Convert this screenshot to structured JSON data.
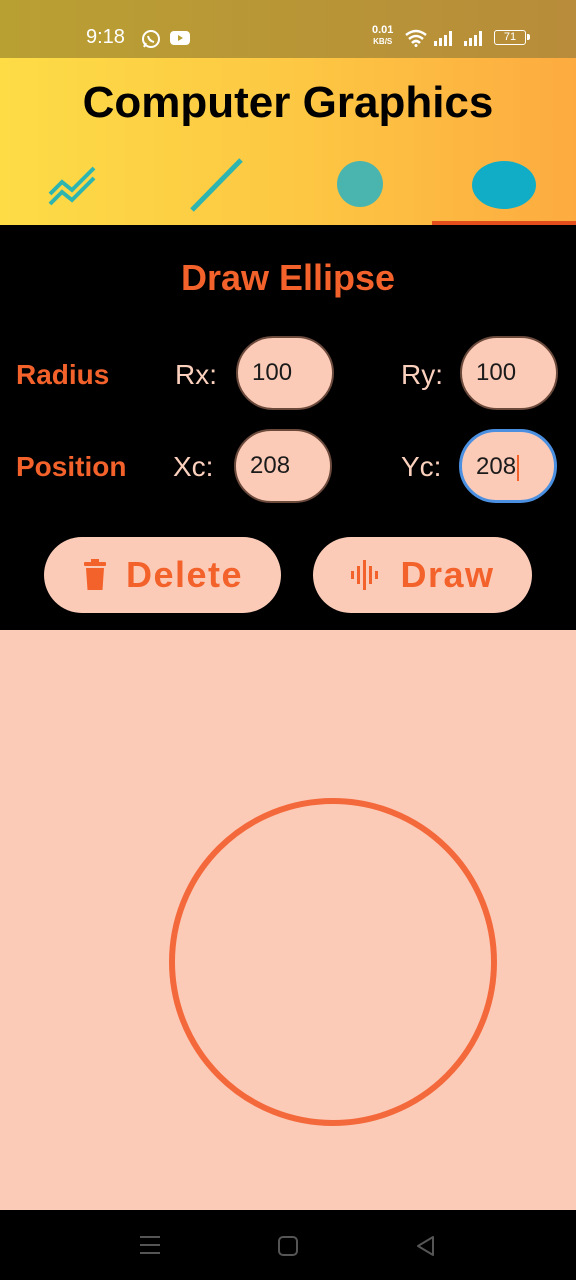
{
  "status_bar": {
    "time": "9:18",
    "net_speed": "0.01",
    "net_unit": "KB/S",
    "battery": "71"
  },
  "app": {
    "title": "Computer Graphics"
  },
  "tabs": [
    {
      "icon": "polyline-icon",
      "selected": false
    },
    {
      "icon": "line-icon",
      "selected": false
    },
    {
      "icon": "circle-icon",
      "selected": false
    },
    {
      "icon": "ellipse-icon",
      "selected": true
    }
  ],
  "form": {
    "title": "Draw Ellipse",
    "radius": {
      "label": "Radius",
      "rx_label": "Rx:",
      "rx_value": "100",
      "ry_label": "Ry:",
      "ry_value": "100"
    },
    "position": {
      "label": "Position",
      "xc_label": "Xc:",
      "xc_value": "208",
      "yc_label": "Yc:",
      "yc_value": "208"
    }
  },
  "buttons": {
    "delete": "Delete",
    "draw": "Draw"
  },
  "colors": {
    "accent": "#f4622b",
    "field_bg": "#fccbb8",
    "teal": "#2fb5b0",
    "header_start": "#fddc46",
    "header_end": "#fdab40"
  }
}
